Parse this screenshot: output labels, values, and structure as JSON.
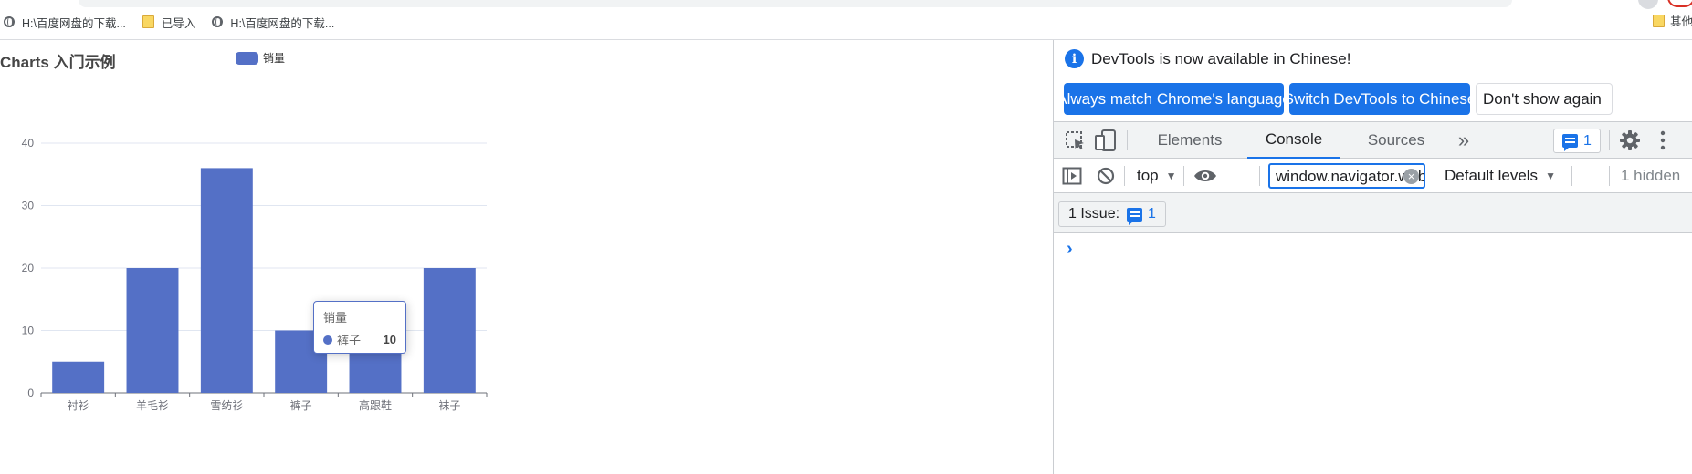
{
  "bookmarks": {
    "items": [
      {
        "label": "H:\\百度网盘的下载...",
        "icon": "globe-icon"
      },
      {
        "label": "已导入",
        "icon": "folder-icon"
      },
      {
        "label": "H:\\百度网盘的下载...",
        "icon": "globe-icon"
      }
    ],
    "other_label": "其他"
  },
  "chart": {
    "title": "Charts 入门示例",
    "legend_label": "销量",
    "tooltip": {
      "title": "销量",
      "item": "裤子",
      "value": "10"
    }
  },
  "chart_data": {
    "type": "bar",
    "title": "Charts 入门示例",
    "categories": [
      "衬衫",
      "羊毛衫",
      "雪纺衫",
      "裤子",
      "高跟鞋",
      "袜子"
    ],
    "series": [
      {
        "name": "销量",
        "values": [
          5,
          20,
          36,
          10,
          10,
          20
        ]
      }
    ],
    "yticks": [
      0,
      10,
      20,
      30,
      40
    ],
    "ylim": [
      0,
      40
    ],
    "grid": true,
    "legend_position": "top",
    "color": "#5470c6"
  },
  "devtools": {
    "banner": {
      "message": "DevTools is now available in Chinese!",
      "btn_match": "Always match Chrome's language",
      "btn_switch": "Switch DevTools to Chinese",
      "btn_dismiss": "Don't show again"
    },
    "tabs": {
      "elements": "Elements",
      "console": "Console",
      "sources": "Sources",
      "more": "»"
    },
    "issues_badge": "1",
    "toolbar": {
      "context": "top",
      "filter_value": "window.navigator.webdriver",
      "levels": "Default levels",
      "hidden": "1 hidden"
    },
    "issues": {
      "label": "1 Issue:",
      "count": "1"
    },
    "prompt": "›"
  },
  "colors": {
    "accent": "#1a73e8",
    "bar": "#5470c6"
  }
}
